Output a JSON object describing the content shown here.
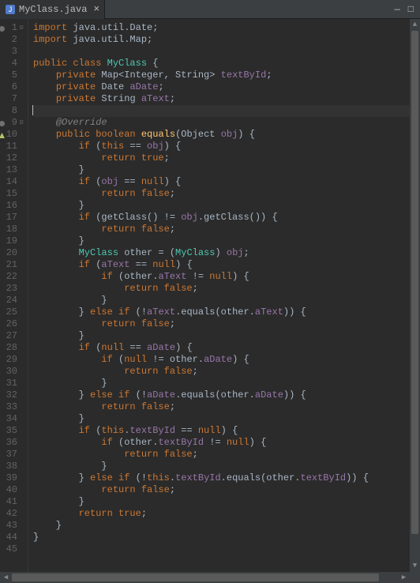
{
  "tab": {
    "filename": "MyClass.java",
    "close_glyph": "×"
  },
  "window": {
    "minimize_glyph": "—",
    "maximize_glyph": "□"
  },
  "gutter": {
    "total_lines": 45,
    "collapse_glyph": "⊟",
    "override_marker_line": 9,
    "triangle_marker_line": 10,
    "cursor_line": 8
  },
  "code": {
    "lines": [
      {
        "n": 1,
        "tokens": [
          [
            "kw",
            "import"
          ],
          [
            "punct",
            " java.util.Date;"
          ]
        ]
      },
      {
        "n": 2,
        "tokens": [
          [
            "kw",
            "import"
          ],
          [
            "punct",
            " java.util.Map;"
          ]
        ]
      },
      {
        "n": 3,
        "tokens": []
      },
      {
        "n": 4,
        "tokens": [
          [
            "kw",
            "public class "
          ],
          [
            "cls",
            "MyClass"
          ],
          [
            "punct",
            " {"
          ]
        ]
      },
      {
        "n": 5,
        "tokens": [
          [
            "punct",
            "    "
          ],
          [
            "kw",
            "private"
          ],
          [
            "punct",
            " Map<Integer, String> "
          ],
          [
            "id",
            "textById"
          ],
          [
            "punct",
            ";"
          ]
        ]
      },
      {
        "n": 6,
        "tokens": [
          [
            "punct",
            "    "
          ],
          [
            "kw",
            "private"
          ],
          [
            "punct",
            " Date "
          ],
          [
            "id",
            "aDate"
          ],
          [
            "punct",
            ";"
          ]
        ]
      },
      {
        "n": 7,
        "tokens": [
          [
            "punct",
            "    "
          ],
          [
            "kw",
            "private"
          ],
          [
            "punct",
            " String "
          ],
          [
            "id",
            "aText"
          ],
          [
            "punct",
            ";"
          ]
        ]
      },
      {
        "n": 8,
        "tokens": [],
        "cursor": true
      },
      {
        "n": 9,
        "tokens": [
          [
            "punct",
            "    "
          ],
          [
            "comment-annotation",
            "@Override"
          ]
        ]
      },
      {
        "n": 10,
        "tokens": [
          [
            "punct",
            "    "
          ],
          [
            "kw",
            "public boolean "
          ],
          [
            "method",
            "equals"
          ],
          [
            "punct",
            "("
          ],
          [
            "type",
            "Object "
          ],
          [
            "id",
            "obj"
          ],
          [
            "punct",
            ") {"
          ]
        ]
      },
      {
        "n": 11,
        "tokens": [
          [
            "punct",
            "        "
          ],
          [
            "kw",
            "if"
          ],
          [
            "punct",
            " ("
          ],
          [
            "kw",
            "this"
          ],
          [
            "punct",
            " == "
          ],
          [
            "id",
            "obj"
          ],
          [
            "punct",
            ") {"
          ]
        ]
      },
      {
        "n": 12,
        "tokens": [
          [
            "punct",
            "            "
          ],
          [
            "kw",
            "return true"
          ],
          [
            "punct",
            ";"
          ]
        ]
      },
      {
        "n": 13,
        "tokens": [
          [
            "punct",
            "        }"
          ]
        ]
      },
      {
        "n": 14,
        "tokens": [
          [
            "punct",
            "        "
          ],
          [
            "kw",
            "if"
          ],
          [
            "punct",
            " ("
          ],
          [
            "id",
            "obj"
          ],
          [
            "punct",
            " == "
          ],
          [
            "kw",
            "null"
          ],
          [
            "punct",
            ") {"
          ]
        ]
      },
      {
        "n": 15,
        "tokens": [
          [
            "punct",
            "            "
          ],
          [
            "kw",
            "return false"
          ],
          [
            "punct",
            ";"
          ]
        ]
      },
      {
        "n": 16,
        "tokens": [
          [
            "punct",
            "        }"
          ]
        ]
      },
      {
        "n": 17,
        "tokens": [
          [
            "punct",
            "        "
          ],
          [
            "kw",
            "if"
          ],
          [
            "punct",
            " (getClass() != "
          ],
          [
            "id",
            "obj"
          ],
          [
            "punct",
            ".getClass()) {"
          ]
        ]
      },
      {
        "n": 18,
        "tokens": [
          [
            "punct",
            "            "
          ],
          [
            "kw",
            "return false"
          ],
          [
            "punct",
            ";"
          ]
        ]
      },
      {
        "n": 19,
        "tokens": [
          [
            "punct",
            "        }"
          ]
        ]
      },
      {
        "n": 20,
        "tokens": [
          [
            "punct",
            "        "
          ],
          [
            "cls",
            "MyClass"
          ],
          [
            "punct",
            " other = ("
          ],
          [
            "cls",
            "MyClass"
          ],
          [
            "punct",
            ") "
          ],
          [
            "id",
            "obj"
          ],
          [
            "punct",
            ";"
          ]
        ]
      },
      {
        "n": 21,
        "tokens": [
          [
            "punct",
            "        "
          ],
          [
            "kw",
            "if"
          ],
          [
            "punct",
            " ("
          ],
          [
            "id",
            "aText"
          ],
          [
            "punct",
            " == "
          ],
          [
            "kw",
            "null"
          ],
          [
            "punct",
            ") {"
          ]
        ]
      },
      {
        "n": 22,
        "tokens": [
          [
            "punct",
            "            "
          ],
          [
            "kw",
            "if"
          ],
          [
            "punct",
            " (other."
          ],
          [
            "id",
            "aText"
          ],
          [
            "punct",
            " != "
          ],
          [
            "kw",
            "null"
          ],
          [
            "punct",
            ") {"
          ]
        ]
      },
      {
        "n": 23,
        "tokens": [
          [
            "punct",
            "                "
          ],
          [
            "kw",
            "return false"
          ],
          [
            "punct",
            ";"
          ]
        ]
      },
      {
        "n": 24,
        "tokens": [
          [
            "punct",
            "            }"
          ]
        ]
      },
      {
        "n": 25,
        "tokens": [
          [
            "punct",
            "        } "
          ],
          [
            "kw",
            "else if"
          ],
          [
            "punct",
            " (!"
          ],
          [
            "id",
            "aText"
          ],
          [
            "punct",
            ".equals(other."
          ],
          [
            "id",
            "aText"
          ],
          [
            "punct",
            ")) {"
          ]
        ]
      },
      {
        "n": 26,
        "tokens": [
          [
            "punct",
            "            "
          ],
          [
            "kw",
            "return false"
          ],
          [
            "punct",
            ";"
          ]
        ]
      },
      {
        "n": 27,
        "tokens": [
          [
            "punct",
            "        }"
          ]
        ]
      },
      {
        "n": 28,
        "tokens": [
          [
            "punct",
            "        "
          ],
          [
            "kw",
            "if"
          ],
          [
            "punct",
            " ("
          ],
          [
            "kw",
            "null"
          ],
          [
            "punct",
            " == "
          ],
          [
            "id",
            "aDate"
          ],
          [
            "punct",
            ") {"
          ]
        ]
      },
      {
        "n": 29,
        "tokens": [
          [
            "punct",
            "            "
          ],
          [
            "kw",
            "if"
          ],
          [
            "punct",
            " ("
          ],
          [
            "kw",
            "null"
          ],
          [
            "punct",
            " != other."
          ],
          [
            "id",
            "aDate"
          ],
          [
            "punct",
            ") {"
          ]
        ]
      },
      {
        "n": 30,
        "tokens": [
          [
            "punct",
            "                "
          ],
          [
            "kw",
            "return false"
          ],
          [
            "punct",
            ";"
          ]
        ]
      },
      {
        "n": 31,
        "tokens": [
          [
            "punct",
            "            }"
          ]
        ]
      },
      {
        "n": 32,
        "tokens": [
          [
            "punct",
            "        } "
          ],
          [
            "kw",
            "else if"
          ],
          [
            "punct",
            " (!"
          ],
          [
            "id",
            "aDate"
          ],
          [
            "punct",
            ".equals(other."
          ],
          [
            "id",
            "aDate"
          ],
          [
            "punct",
            ")) {"
          ]
        ]
      },
      {
        "n": 33,
        "tokens": [
          [
            "punct",
            "            "
          ],
          [
            "kw",
            "return false"
          ],
          [
            "punct",
            ";"
          ]
        ]
      },
      {
        "n": 34,
        "tokens": [
          [
            "punct",
            "        }"
          ]
        ]
      },
      {
        "n": 35,
        "tokens": [
          [
            "punct",
            "        "
          ],
          [
            "kw",
            "if"
          ],
          [
            "punct",
            " ("
          ],
          [
            "kw",
            "this"
          ],
          [
            "punct",
            "."
          ],
          [
            "id",
            "textById"
          ],
          [
            "punct",
            " == "
          ],
          [
            "kw",
            "null"
          ],
          [
            "punct",
            ") {"
          ]
        ]
      },
      {
        "n": 36,
        "tokens": [
          [
            "punct",
            "            "
          ],
          [
            "kw",
            "if"
          ],
          [
            "punct",
            " (other."
          ],
          [
            "id",
            "textById"
          ],
          [
            "punct",
            " != "
          ],
          [
            "kw",
            "null"
          ],
          [
            "punct",
            ") {"
          ]
        ]
      },
      {
        "n": 37,
        "tokens": [
          [
            "punct",
            "                "
          ],
          [
            "kw",
            "return false"
          ],
          [
            "punct",
            ";"
          ]
        ]
      },
      {
        "n": 38,
        "tokens": [
          [
            "punct",
            "            }"
          ]
        ]
      },
      {
        "n": 39,
        "tokens": [
          [
            "punct",
            "        } "
          ],
          [
            "kw",
            "else if"
          ],
          [
            "punct",
            " (!"
          ],
          [
            "kw",
            "this"
          ],
          [
            "punct",
            "."
          ],
          [
            "id",
            "textById"
          ],
          [
            "punct",
            ".equals(other."
          ],
          [
            "id",
            "textById"
          ],
          [
            "punct",
            ")) {"
          ]
        ]
      },
      {
        "n": 40,
        "tokens": [
          [
            "punct",
            "            "
          ],
          [
            "kw",
            "return false"
          ],
          [
            "punct",
            ";"
          ]
        ]
      },
      {
        "n": 41,
        "tokens": [
          [
            "punct",
            "        }"
          ]
        ]
      },
      {
        "n": 42,
        "tokens": [
          [
            "punct",
            "        "
          ],
          [
            "kw",
            "return true"
          ],
          [
            "punct",
            ";"
          ]
        ]
      },
      {
        "n": 43,
        "tokens": [
          [
            "punct",
            "    }"
          ]
        ]
      },
      {
        "n": 44,
        "tokens": [
          [
            "punct",
            "}"
          ]
        ]
      },
      {
        "n": 45,
        "tokens": []
      }
    ]
  }
}
